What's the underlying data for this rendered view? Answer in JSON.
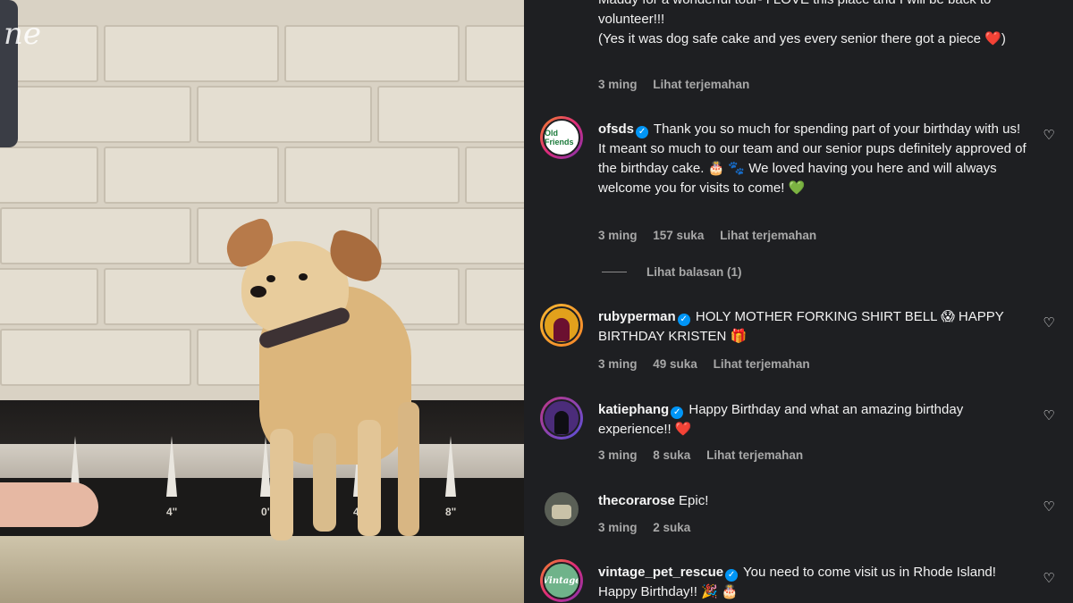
{
  "media": {
    "watermark": "ne",
    "ruler_labels": [
      "4\"",
      "0\"",
      "4\"",
      "8\""
    ]
  },
  "comments": [
    {
      "id": "top-partial",
      "text": "Maddy for a wonderful tour- I LOVE this place and I will be back to volunteer!!!\n(Yes it was dog safe cake and yes every senior there got a piece ❤️)",
      "time": "3 ming",
      "translate": "Lihat terjemahan"
    },
    {
      "id": "ofsds",
      "username": "ofsds",
      "verified": true,
      "avatar_text": "Old Friends",
      "text": "Thank you so much for spending part of your birthday with us! It meant so much to our team and our senior pups definitely approved of the birthday cake. 🎂 🐾 We loved having you here and will always welcome you for visits to come! 💚",
      "time": "3 ming",
      "likes": "157 suka",
      "translate": "Lihat terjemahan"
    },
    {
      "id": "rubyperman",
      "username": "rubyperman",
      "verified": true,
      "text": "HOLY MOTHER FORKING SHIRT BELL 😱 HAPPY BIRTHDAY KRISTEN 🎁",
      "time": "3 ming",
      "likes": "49 suka",
      "translate": "Lihat terjemahan"
    },
    {
      "id": "katiephang",
      "username": "katiephang",
      "verified": true,
      "text": "Happy Birthday and what an amazing birthday experience!! ❤️",
      "time": "3 ming",
      "likes": "8 suka",
      "translate": "Lihat terjemahan"
    },
    {
      "id": "thecorarose",
      "username": "thecorarose",
      "verified": false,
      "text": "Epic!",
      "time": "3 ming",
      "likes": "2 suka"
    },
    {
      "id": "vintage_pet_rescue",
      "username": "vintage_pet_rescue",
      "verified": true,
      "avatar_text": "Vintage",
      "text": "You need to come visit us in Rhode Island! Happy Birthday!! 🎉 🎂"
    }
  ],
  "replies_link": "Lihat balasan (1)",
  "colors": {
    "panel_bg": "#1e1f22",
    "muted": "#a8a8a8",
    "verified": "#0095f6"
  }
}
